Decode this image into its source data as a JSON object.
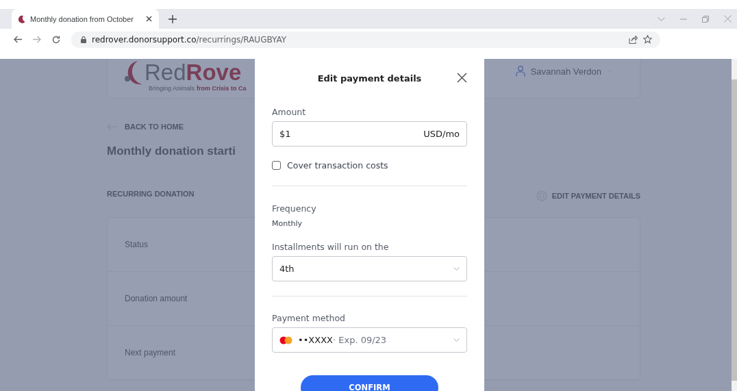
{
  "browser": {
    "tab": {
      "title": "Monthly donation from October"
    },
    "url": {
      "host": "redrover.donorsupport.co",
      "path": "/recurrings/RAUGBYAY"
    }
  },
  "page": {
    "logo": {
      "part_1": "Red",
      "part_2": "Rove",
      "tagline_1": "Bringing Animals",
      "tagline_2": "from Crisis to Ca"
    },
    "user_menu": "Savannah Verdon",
    "back_link": "BACK TO HOME",
    "heading": "Monthly donation starti",
    "section_label": "RECURRING DONATION",
    "edit_link": "EDIT PAYMENT DETAILS",
    "rows": [
      "Status",
      "Donation amount",
      "Next payment"
    ]
  },
  "modal": {
    "title": "Edit payment details",
    "amount": {
      "label": "Amount",
      "value": "$1",
      "unit": "USD/mo"
    },
    "cover_costs": {
      "label": "Cover transaction costs",
      "checked": false
    },
    "frequency": {
      "label": "Frequency",
      "value": "Monthly"
    },
    "installments": {
      "label": "Installments will run on the",
      "value": "4th"
    },
    "payment_method": {
      "label": "Payment method",
      "masked": "••XXXX",
      "expiry": "· Exp. 09/23"
    },
    "confirm": "CONFIRM"
  }
}
